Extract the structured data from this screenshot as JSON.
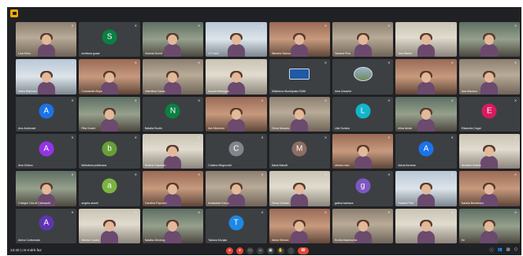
{
  "app": {
    "name": "Google Meet"
  },
  "meeting": {
    "time": "13:40",
    "separator": "|",
    "code": "ctr-mdrk-faz"
  },
  "colors": {
    "background": "#202124",
    "tile": "#3c4043",
    "leave": "#ea4335",
    "logo": "#f9ab00"
  },
  "participants": [
    {
      "name": "Lina Mînz...",
      "type": "video"
    },
    {
      "name": "svetlana gusar",
      "type": "avatar",
      "initial": "S",
      "color": "#0b8043"
    },
    {
      "name": "Victoria Dumit",
      "type": "video"
    },
    {
      "name": "CTI Ialol",
      "type": "video"
    },
    {
      "name": "Mihaela Stanco",
      "type": "video"
    },
    {
      "name": "Tamara Puiu",
      "type": "video"
    },
    {
      "name": "Vera Barbu",
      "type": "video"
    },
    {
      "name": "",
      "type": "video"
    },
    {
      "name": "Maria Bejenaru",
      "type": "video"
    },
    {
      "name": "Constantin Bujor",
      "type": "video"
    },
    {
      "name": "Valentina Cazac",
      "type": "video"
    },
    {
      "name": "Ancuta Mirongas",
      "type": "video"
    },
    {
      "name": "Biblioteca Municipala ISAM",
      "type": "badge"
    },
    {
      "name": "Irina Ursache",
      "type": "badge-photo"
    },
    {
      "name": "",
      "type": "video"
    },
    {
      "name": "Ana Mocanu",
      "type": "video"
    },
    {
      "name": "Ana Ambrosie",
      "type": "avatar",
      "initial": "A",
      "color": "#1a73e8"
    },
    {
      "name": "Rita Cusnir",
      "type": "video"
    },
    {
      "name": "Natalia Scutin",
      "type": "avatar",
      "initial": "N",
      "color": "#0b8043"
    },
    {
      "name": "Ala Klimenko",
      "type": "video"
    },
    {
      "name": "Elena Mocanu",
      "type": "video"
    },
    {
      "name": "Lilia Surlaru",
      "type": "avatar",
      "initial": "L",
      "color": "#12b5cb"
    },
    {
      "name": "elina benia",
      "type": "video"
    },
    {
      "name": "Elisaveta Cogal",
      "type": "avatar",
      "initial": "E",
      "color": "#d81b60"
    },
    {
      "name": "Ana Glebov",
      "type": "avatar",
      "initial": "A",
      "color": "#9334e6"
    },
    {
      "name": "biblioteca publicana",
      "type": "avatar",
      "initial": "b",
      "color": "#689f38"
    },
    {
      "name": "Rodica Cojocaru",
      "type": "video"
    },
    {
      "name": "Cristina Mirgorodci",
      "type": "avatar",
      "initial": "C",
      "color": "#80868b"
    },
    {
      "name": "Maria Manoli",
      "type": "avatar",
      "initial": "M",
      "color": "#8d6e63"
    },
    {
      "name": "olesea rusu",
      "type": "video"
    },
    {
      "name": "Alena Avrama",
      "type": "avatar",
      "initial": "A",
      "color": "#1a73e8"
    },
    {
      "name": "Nicoleta Varlam",
      "type": "video"
    },
    {
      "name": "Colegiul Ciuruii Ciuhuschi",
      "type": "video"
    },
    {
      "name": "angela arachi",
      "type": "avatar",
      "initial": "a",
      "color": "#7cb342"
    },
    {
      "name": "Carolina Popovici",
      "type": "video"
    },
    {
      "name": "Anastasia Grecu",
      "type": "video"
    },
    {
      "name": "Elena Cristian",
      "type": "video"
    },
    {
      "name": "galina barbaca",
      "type": "avatar",
      "initial": "g",
      "color": "#7e57c2"
    },
    {
      "name": "Natalia Phat",
      "type": "video"
    },
    {
      "name": "Natalia Bordeianu",
      "type": "video"
    },
    {
      "name": "Alena Cortronado",
      "type": "avatar",
      "initial": "A",
      "color": "#5e35b1"
    },
    {
      "name": "Marina Coslov",
      "type": "video"
    },
    {
      "name": "Natalia Zdrobog",
      "type": "video"
    },
    {
      "name": "Tatiana Munjac",
      "type": "avatar",
      "initial": "T",
      "color": "#1e88e5"
    },
    {
      "name": "Maria Sfirnciu",
      "type": "video"
    },
    {
      "name": "Emilia Macinschis",
      "type": "video"
    },
    {
      "name": "",
      "type": "video"
    },
    {
      "name": "Ee",
      "type": "video"
    }
  ],
  "controls": {
    "icons": [
      "emoji-hand-icon",
      "captions-icon",
      "present-icon",
      "emoji-icon",
      "raise-hand-icon",
      "more-icon"
    ],
    "leave_icon": "call-end-icon"
  },
  "right_controls": [
    "info-icon",
    "people-icon",
    "chat-icon",
    "activities-icon"
  ]
}
